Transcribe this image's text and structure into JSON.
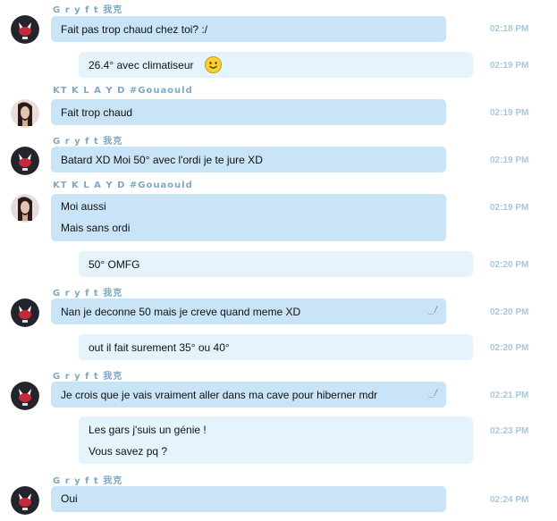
{
  "senders": {
    "gryft": "G r y f t 我克",
    "klayd": "KT  K L A Y D #Gouaould"
  },
  "messages": [
    {
      "text": "Fait pas trop chaud chez toi? :/",
      "time": "02:18 PM"
    },
    {
      "text": "26.4° avec climatiseur",
      "time": "02:19 PM",
      "icon": "smiley-icon"
    },
    {
      "text": "Fait trop chaud",
      "time": "02:19 PM"
    },
    {
      "text": "Batard XD Moi 50° avec l'ordi je te jure XD",
      "time": "02:19 PM"
    },
    {
      "lines": [
        "Moi aussi",
        "Mais sans ordi"
      ],
      "time": "02:19 PM"
    },
    {
      "text": "50° OMFG",
      "time": "02:20 PM"
    },
    {
      "text": "Nan je deconne 50 mais je creve quand meme XD",
      "time": "02:20 PM"
    },
    {
      "text": "out il fait surement 35° ou 40°",
      "time": "02:20 PM"
    },
    {
      "text": "Je crois que je vais vraiment aller dans ma cave pour hiberner mdr",
      "time": "02:21 PM"
    },
    {
      "lines": [
        "Les gars j'suis un génie !",
        "Vous savez pq ?"
      ],
      "time": "02:23 PM"
    },
    {
      "text": "Oui",
      "time": "02:24 PM"
    }
  ],
  "colors": {
    "incoming_bubble": "#c9e4f6",
    "outgoing_bubble": "#e5f3fc",
    "sender_name": "#7ea8c4",
    "timestamp": "#a9c7dc"
  }
}
